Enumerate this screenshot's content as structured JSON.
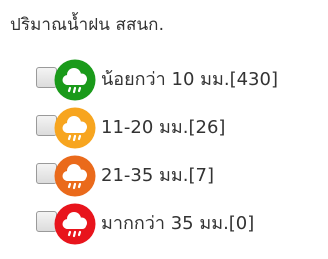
{
  "panel": {
    "title": "ปริมาณน้ำฝน สสนก."
  },
  "legend": {
    "items": [
      {
        "label": "น้อยกว่า 10 มม.[430]",
        "color": "#1a9a1a",
        "icon": "rain-cloud-icon",
        "checked": false
      },
      {
        "label": "11-20 มม.[26]",
        "color": "#f7a51f",
        "icon": "rain-cloud-icon",
        "checked": false
      },
      {
        "label": "21-35 มม.[7]",
        "color": "#ea6a1b",
        "icon": "rain-cloud-icon",
        "checked": false
      },
      {
        "label": "มากกว่า 35 มม.[0]",
        "color": "#e8141c",
        "icon": "rain-cloud-icon",
        "checked": false
      }
    ]
  }
}
